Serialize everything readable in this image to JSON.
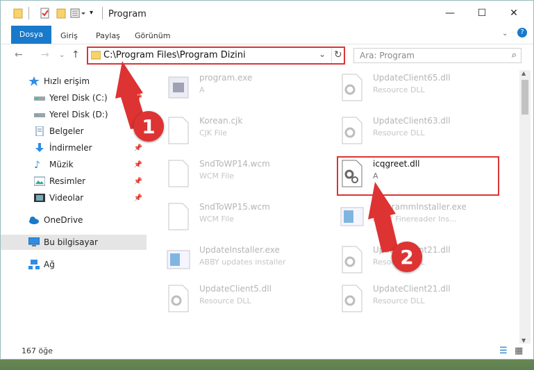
{
  "window": {
    "title": "Program"
  },
  "ribbon": {
    "tabs": [
      "Dosya",
      "Giriş",
      "Paylaş",
      "Görünüm"
    ]
  },
  "address": {
    "path": "C:\\Program Files\\Program Dizini"
  },
  "search": {
    "placeholder": "Ara: Program"
  },
  "sidebar": {
    "items": [
      {
        "label": "Hızlı erişim",
        "icon": "star-icon",
        "pinned": false
      },
      {
        "label": "Yerel Disk (C:)",
        "icon": "drive-icon",
        "pinned": true
      },
      {
        "label": "Yerel Disk (D:)",
        "icon": "drive-icon",
        "pinned": true
      },
      {
        "label": "Belgeler",
        "icon": "document-icon",
        "pinned": true
      },
      {
        "label": "İndirmeler",
        "icon": "download-icon",
        "pinned": true
      },
      {
        "label": "Müzik",
        "icon": "music-icon",
        "pinned": true
      },
      {
        "label": "Resimler",
        "icon": "pictures-icon",
        "pinned": true
      },
      {
        "label": "Videolar",
        "icon": "video-icon",
        "pinned": true
      },
      {
        "label": "OneDrive",
        "icon": "cloud-icon",
        "pinned": false
      },
      {
        "label": "Bu bilgisayar",
        "icon": "computer-icon",
        "pinned": false
      },
      {
        "label": "Ağ",
        "icon": "network-icon",
        "pinned": false
      }
    ]
  },
  "files": [
    {
      "name": "program.exe",
      "type": "A"
    },
    {
      "name": "UpdateClient65.dll",
      "type": "Resource DLL"
    },
    {
      "name": "Korean.cjk",
      "type": "CJK File"
    },
    {
      "name": "UpdateClient63.dll",
      "type": "Resource DLL"
    },
    {
      "name": "SndToWP14.wcm",
      "type": "WCM File"
    },
    {
      "name": "icqgreet.dll",
      "type": "A"
    },
    {
      "name": "SndToWP15.wcm",
      "type": "WCM File"
    },
    {
      "name": "ProgrammInstaller.exe",
      "type": "ABBY Finereader Ins..."
    },
    {
      "name": "UpdateInstaller.exe",
      "type": "ABBY updates installer"
    },
    {
      "name": "UpdateClient21.dll",
      "type": "Resource DLL"
    },
    {
      "name": "UpdateClient5.dll",
      "type": "Resource DLL"
    },
    {
      "name": "UpdateClient21.dll",
      "type": "Resource DLL"
    }
  ],
  "status": {
    "count": "167 öğe"
  },
  "markers": [
    "1",
    "2"
  ],
  "colors": {
    "accent": "#1979ca",
    "highlight": "#dd3333"
  }
}
